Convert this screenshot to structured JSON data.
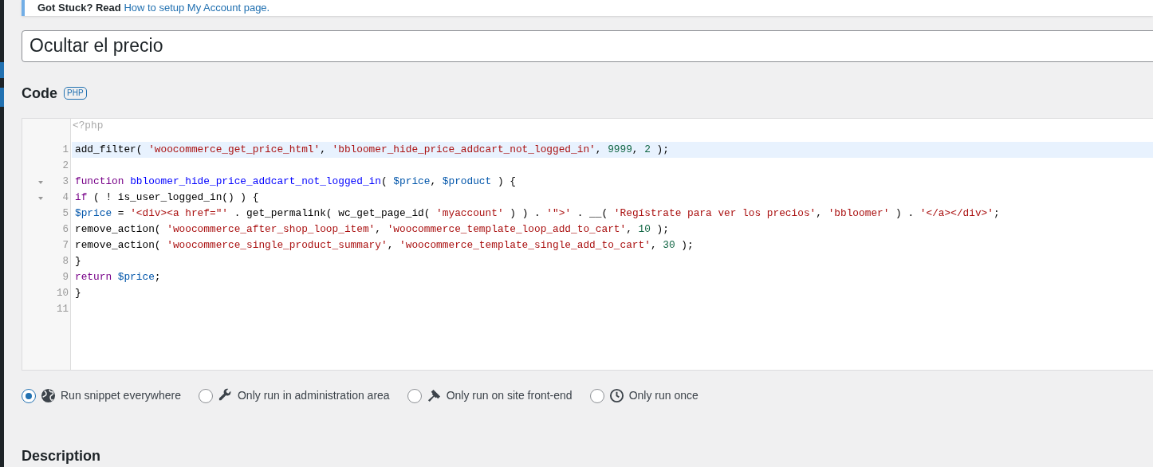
{
  "notice": {
    "text": "Got Stuck? Read",
    "link": "How to setup My Account page."
  },
  "title_field": {
    "value": "Ocultar el precio"
  },
  "code_section": {
    "heading": "Code",
    "badge": "PHP"
  },
  "editor": {
    "preamble": "<?php",
    "lines": [
      {
        "number": "1",
        "active": true,
        "foldable": false,
        "tokens": [
          {
            "kind": "plain",
            "text": "add_filter( "
          },
          {
            "kind": "string",
            "text": "'woocommerce_get_price_html'"
          },
          {
            "kind": "plain",
            "text": ", "
          },
          {
            "kind": "string",
            "text": "'bbloomer_hide_price_addcart_not_logged_in'"
          },
          {
            "kind": "plain",
            "text": ", "
          },
          {
            "kind": "number",
            "text": "9999"
          },
          {
            "kind": "plain",
            "text": ", "
          },
          {
            "kind": "number",
            "text": "2"
          },
          {
            "kind": "plain",
            "text": " );"
          }
        ]
      },
      {
        "number": "2",
        "active": false,
        "foldable": false
      },
      {
        "number": "3",
        "active": false,
        "foldable": true,
        "tokens": [
          {
            "kind": "keyword",
            "text": "function "
          },
          {
            "kind": "def",
            "text": "bbloomer_hide_price_addcart_not_logged_in"
          },
          {
            "kind": "plain",
            "text": "( "
          },
          {
            "kind": "variable",
            "text": "$price"
          },
          {
            "kind": "plain",
            "text": ", "
          },
          {
            "kind": "variable",
            "text": "$product"
          },
          {
            "kind": "plain",
            "text": " ) {"
          }
        ]
      },
      {
        "number": "4",
        "active": false,
        "foldable": true,
        "tokens": [
          {
            "kind": "keyword",
            "text": "if"
          },
          {
            "kind": "plain",
            "text": " ( ! is_user_logged_in() ) {"
          }
        ]
      },
      {
        "number": "5",
        "active": false,
        "foldable": false,
        "tokens": [
          {
            "kind": "variable",
            "text": "$price"
          },
          {
            "kind": "plain",
            "text": " = "
          },
          {
            "kind": "string",
            "text": "'<div><a href=\"'"
          },
          {
            "kind": "plain",
            "text": " . get_permalink( wc_get_page_id( "
          },
          {
            "kind": "string",
            "text": "'myaccount'"
          },
          {
            "kind": "plain",
            "text": " ) ) . "
          },
          {
            "kind": "string",
            "text": "'\">'"
          },
          {
            "kind": "plain",
            "text": " . __( "
          },
          {
            "kind": "string",
            "text": "'Regístrate para ver los precios'"
          },
          {
            "kind": "plain",
            "text": ", "
          },
          {
            "kind": "string",
            "text": "'bbloomer'"
          },
          {
            "kind": "plain",
            "text": " ) . "
          },
          {
            "kind": "string",
            "text": "'</a></div>'"
          },
          {
            "kind": "plain",
            "text": ";"
          }
        ]
      },
      {
        "number": "6",
        "active": false,
        "foldable": false,
        "tokens": [
          {
            "kind": "plain",
            "text": "remove_action( "
          },
          {
            "kind": "string",
            "text": "'woocommerce_after_shop_loop_item'"
          },
          {
            "kind": "plain",
            "text": ", "
          },
          {
            "kind": "string",
            "text": "'woocommerce_template_loop_add_to_cart'"
          },
          {
            "kind": "plain",
            "text": ", "
          },
          {
            "kind": "number",
            "text": "10"
          },
          {
            "kind": "plain",
            "text": " );"
          }
        ]
      },
      {
        "number": "7",
        "active": false,
        "foldable": false,
        "tokens": [
          {
            "kind": "plain",
            "text": "remove_action( "
          },
          {
            "kind": "string",
            "text": "'woocommerce_single_product_summary'"
          },
          {
            "kind": "plain",
            "text": ", "
          },
          {
            "kind": "string",
            "text": "'woocommerce_template_single_add_to_cart'"
          },
          {
            "kind": "plain",
            "text": ", "
          },
          {
            "kind": "number",
            "text": "30"
          },
          {
            "kind": "plain",
            "text": " );"
          }
        ]
      },
      {
        "number": "8",
        "active": false,
        "foldable": false,
        "tokens": [
          {
            "kind": "plain",
            "text": "}"
          }
        ]
      },
      {
        "number": "9",
        "active": false,
        "foldable": false,
        "tokens": [
          {
            "kind": "keyword",
            "text": "return "
          },
          {
            "kind": "variable",
            "text": "$price"
          },
          {
            "kind": "plain",
            "text": ";"
          }
        ]
      },
      {
        "number": "10",
        "active": false,
        "foldable": false,
        "tokens": [
          {
            "kind": "plain",
            "text": "}"
          }
        ]
      },
      {
        "number": "11",
        "active": false,
        "foldable": false
      }
    ]
  },
  "scope_options": [
    {
      "label": "Run snippet everywhere",
      "kind": "globe",
      "selected": true
    },
    {
      "label": "Only run in administration area",
      "kind": "wrench",
      "selected": false
    },
    {
      "label": "Only run on site front-end",
      "kind": "brush",
      "selected": false
    },
    {
      "label": "Only run once",
      "kind": "clock",
      "selected": false
    }
  ],
  "description_heading": "Description"
}
